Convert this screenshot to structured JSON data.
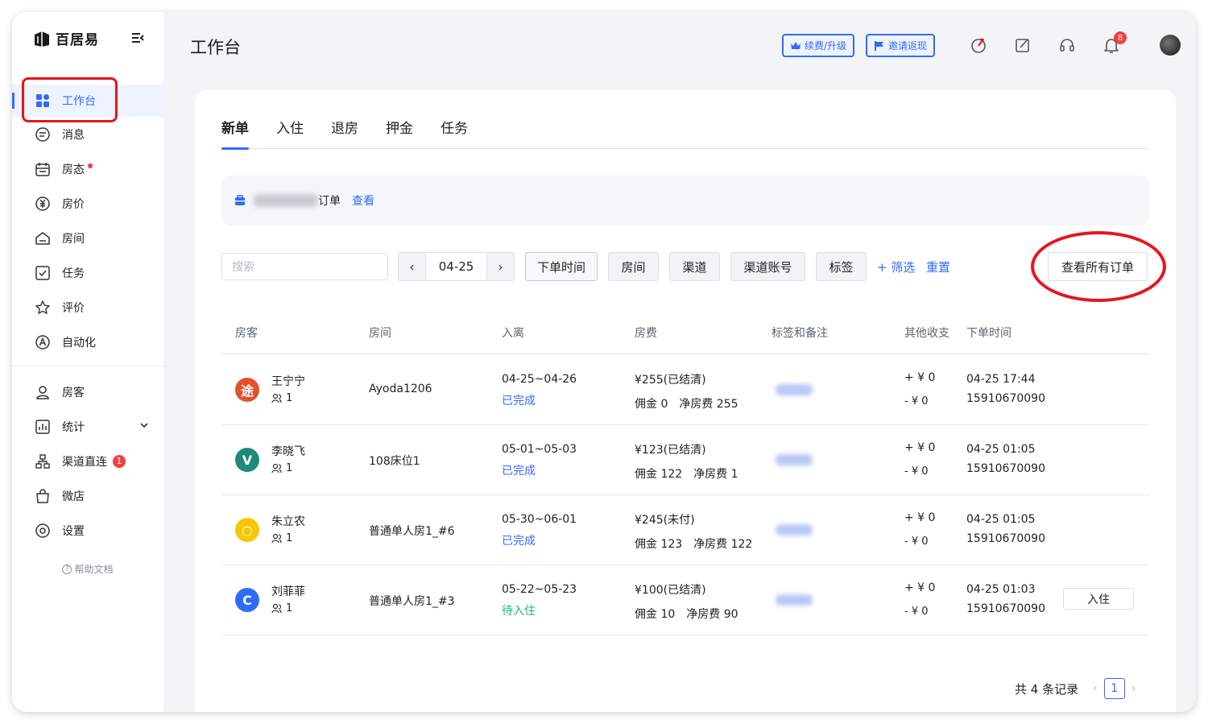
{
  "app": {
    "name": "百居易"
  },
  "sidebar": {
    "items": [
      {
        "label": "工作台",
        "icon": "dashboard-icon",
        "active": true
      },
      {
        "label": "消息",
        "icon": "message-icon"
      },
      {
        "label": "房态",
        "icon": "calendar-icon",
        "dot": true
      },
      {
        "label": "房价",
        "icon": "yuan-icon"
      },
      {
        "label": "房间",
        "icon": "house-icon"
      },
      {
        "label": "任务",
        "icon": "checkbox-icon"
      },
      {
        "label": "评价",
        "icon": "star-icon"
      },
      {
        "label": "自动化",
        "icon": "auto-icon"
      }
    ],
    "items2": [
      {
        "label": "房客",
        "icon": "user-icon"
      },
      {
        "label": "统计",
        "icon": "chart-icon",
        "expand": true
      },
      {
        "label": "渠道直连",
        "icon": "channel-icon",
        "badge": "1"
      },
      {
        "label": "微店",
        "icon": "shop-icon"
      },
      {
        "label": "设置",
        "icon": "gear-icon"
      }
    ],
    "help": "帮助文档"
  },
  "header": {
    "title": "工作台",
    "renew_label": "续费/升级",
    "invite_label": "邀请返现",
    "bell_count": "8"
  },
  "tabs": [
    "新单",
    "入住",
    "退房",
    "押金",
    "任务"
  ],
  "notice": {
    "text": "订单",
    "link": "查看"
  },
  "filters": {
    "search_placeholder": "搜索",
    "date": "04-25",
    "order_time": "下单时间",
    "room": "房间",
    "channel": "渠道",
    "channel_account": "渠道账号",
    "tag": "标签",
    "filter_link": "+ 筛选",
    "reset_link": "重置",
    "view_all": "查看所有订单"
  },
  "table": {
    "headers": [
      "房客",
      "房间",
      "入离",
      "房费",
      "标签和备注",
      "其他收支",
      "下单时间"
    ],
    "rows": [
      {
        "channel_icon": "tujia-logo-icon",
        "channel_color": "#e4512c",
        "glyph": "途",
        "guest": "王宁宁",
        "count": "1",
        "room": "Ayoda1206",
        "dates": "04-25~04-26",
        "status": "已完成",
        "status_type": "done",
        "fee": "¥255(已结清)",
        "commission": "佣金 0",
        "net": "净房费 255",
        "income": "+ ¥ 0",
        "expense": "- ¥ 0",
        "time": "04-25 17:44",
        "phone": "15910670090"
      },
      {
        "channel_icon": "xiaozhu-logo-icon",
        "channel_color": "#1f8a78",
        "glyph": "V",
        "guest": "李晓飞",
        "count": "1",
        "room": "108床位1",
        "dates": "05-01~05-03",
        "status": "已完成",
        "status_type": "done",
        "fee": "¥123(已结清)",
        "commission": "佣金 122",
        "net": "净房费 1",
        "income": "+ ¥ 0",
        "expense": "- ¥ 0",
        "time": "04-25 01:05",
        "phone": "15910670090"
      },
      {
        "channel_icon": "meituan-logo-icon",
        "channel_color": "#f7c600",
        "glyph": "○",
        "guest": "朱立农",
        "count": "1",
        "room": "普通单人房1_#6",
        "dates": "05-30~06-01",
        "status": "已完成",
        "status_type": "done",
        "fee": "¥245(未付)",
        "commission": "佣金 123",
        "net": "净房费 122",
        "income": "+ ¥ 0",
        "expense": "- ¥ 0",
        "time": "04-25 01:05",
        "phone": "15910670090"
      },
      {
        "channel_icon": "ctrip-logo-icon",
        "channel_color": "#2f6bff",
        "glyph": "C",
        "guest": "刘菲菲",
        "count": "1",
        "room": "普通单人房1_#3",
        "dates": "05-22~05-23",
        "status": "待入住",
        "status_type": "pending",
        "fee": "¥100(已结清)",
        "commission": "佣金 10",
        "net": "净房费 90",
        "income": "+ ¥ 0",
        "expense": "- ¥ 0",
        "time": "04-25 01:03",
        "phone": "15910670090",
        "action": "入住"
      }
    ]
  },
  "pagination": {
    "total_text": "共 4 条记录",
    "page": "1"
  },
  "colors": {
    "accent": "#2f6bff",
    "annotation": "#e8141c",
    "success": "#14b86a"
  }
}
